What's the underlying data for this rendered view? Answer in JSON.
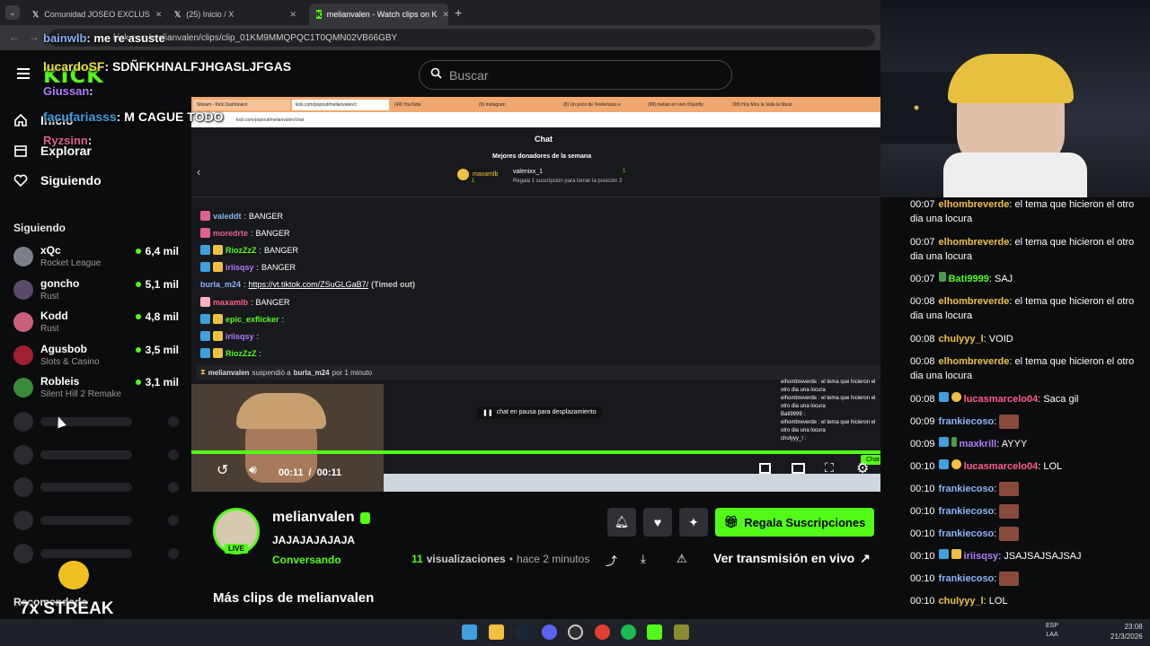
{
  "browser": {
    "tabs": [
      {
        "label": "Comunidad JOSEO EXCLUS",
        "active": false
      },
      {
        "label": "(25) Inicio / X",
        "active": false
      },
      {
        "label": "melianvalen - Watch clips on K",
        "active": true
      }
    ],
    "new_tab": "+",
    "url": "kick.com/melianvalen/clips/clip_01KM9MMQPQC1T0QMN02VB66GBY"
  },
  "kick": {
    "logo": "KICK",
    "search_placeholder": "Buscar",
    "nav": [
      {
        "label": "Inicio",
        "icon": "home-icon"
      },
      {
        "label": "Explorar",
        "icon": "compass-icon"
      },
      {
        "label": "Siguiendo",
        "icon": "heart-icon"
      }
    ],
    "following_title": "Siguiendo",
    "following": [
      {
        "name": "xQc",
        "game": "Rocket League",
        "viewers": "6,4 mil",
        "color": "#7a7f8a"
      },
      {
        "name": "goncho",
        "game": "Rust",
        "viewers": "5,1 mil",
        "color": "#5a4a6a"
      },
      {
        "name": "Kodd",
        "game": "Rust",
        "viewers": "4,8 mil",
        "color": "#c8607a"
      },
      {
        "name": "Agusbob",
        "game": "Slots & Casino",
        "viewers": "3,5 mil",
        "color": "#a02030"
      },
      {
        "name": "Robleis",
        "game": "Silent Hill 2 Remake",
        "viewers": "3,1 mil",
        "color": "#3a8a3a"
      }
    ],
    "recommended_title": "Recomendado"
  },
  "video": {
    "inner_tabs": [
      "Stream - Kick Dashboard",
      "kick.com/popout/melianvalen/c",
      "(49) YouTube",
      "(9) Instagram",
      "(8) Un poco de Tendencias e",
      "(98) melian en vivo #Spotify",
      "(98) Hoy Miru la Valla la Music"
    ],
    "inner_url": "kick.com/popout/melianvalen/chat",
    "chat_title": "Chat",
    "donors_title": "Mejores donadores de la semana",
    "donors": [
      {
        "name": "maxamlb",
        "count": "1"
      },
      {
        "name": "valenixx_1",
        "count": "1"
      }
    ],
    "donor_hint": "Regala 1 suscripción para tomar la posición 3",
    "messages": [
      {
        "user": "valeddt",
        "color": "#8ab4f8",
        "text": "BANGER"
      },
      {
        "user": "moredrte",
        "color": "#e06090",
        "text": "BANGER"
      },
      {
        "user": "RiozZzZ",
        "color": "#53fc18",
        "text": "BANGER"
      },
      {
        "user": "iriisqsy",
        "color": "#b07cff",
        "text": "BANGER"
      },
      {
        "user": "burla_m24",
        "color": "#8ab4f8",
        "text": "https://vt.tiktok.com/ZSuGLGaB7/",
        "suffix": "(Timed out)"
      },
      {
        "user": "maxamlb",
        "color": "#ff5e8a",
        "text": "BANGER"
      },
      {
        "user": "epic_exflicker",
        "color": "#53fc18",
        "text": ""
      },
      {
        "user": "iriisqsy",
        "color": "#b07cff",
        "text": ""
      },
      {
        "user": "RiozZzZ",
        "color": "#53fc18",
        "text": ""
      }
    ],
    "mod_action": {
      "mod": "melianvalen",
      "action": "suspendió a",
      "target": "burla_m24",
      "duration": "por 1 minuto"
    },
    "paused": "chat en pausa para desplazamiento",
    "time_current": "00:11",
    "time_sep": "/",
    "time_total": "00:11",
    "progress": 1.0,
    "mini_chat": [
      "elhombreverde : el tema que hicieron el",
      "otro dia una locura",
      "elhombreverde : el tema que hicieron el",
      "otro dia una locura",
      "Bati9999 :",
      "elhombreverde : el tema que hicieron el",
      "otro dia una locura",
      "chulyyy_l :"
    ],
    "mini_chat_button": "Chat"
  },
  "clip": {
    "streamer": "melianvalen",
    "title": "JAJAJAJAJAJA",
    "category": "Conversando",
    "live_badge": "LIVE",
    "views": "11",
    "views_label": "visualizaciones",
    "ago": "hace 2 minutos",
    "gift_button": "Regala Suscripciones",
    "watch_live": "Ver transmisión en vivo",
    "more_clips": "Más clips de melianvalen"
  },
  "overlay": {
    "lines": [
      {
        "user": "bainwlb",
        "text": "me re asuste"
      },
      {
        "user": "lucardoSF",
        "text": "SDÑFKHNALFJHGASLJFGAS"
      },
      {
        "user": "Giussan",
        "text": ""
      },
      {
        "user": "facufariasss",
        "text": "M CAGUE TODO"
      },
      {
        "user": "Ryzsinn",
        "text": ""
      }
    ],
    "streak": "7x STREAK"
  },
  "right_chat": [
    {
      "time": "00:07",
      "user": "elhombreverde",
      "color": "#f0c040",
      "text": "el tema que hicieron el otro dia una locura"
    },
    {
      "time": "00:07",
      "user": "elhombreverde",
      "color": "#f0c040",
      "text": "el tema que hicieron el otro dia una locura"
    },
    {
      "time": "00:07",
      "user": "Bati9999",
      "color": "#53fc18",
      "text": "SAJ"
    },
    {
      "time": "00:08",
      "user": "elhombreverde",
      "color": "#f0c040",
      "text": "el tema que hicieron el otro dia una locura"
    },
    {
      "time": "00:08",
      "user": "chulyyy_l",
      "color": "#f0c040",
      "text": "VOID"
    },
    {
      "time": "00:08",
      "user": "elhombreverde",
      "color": "#f0c040",
      "text": "el tema que hicieron el otro dia una locura"
    },
    {
      "time": "00:08",
      "user": "lucasmarcelo04",
      "color": "#ff5e8a",
      "text": "Saca gil"
    },
    {
      "time": "00:09",
      "user": "frankiecoso",
      "color": "#8ab4f8",
      "text": ""
    },
    {
      "time": "00:09",
      "user": "maxkrill",
      "color": "#b07cff",
      "text": "AYYY"
    },
    {
      "time": "00:10",
      "user": "lucasmarcelo04",
      "color": "#ff5e8a",
      "text": "LOL"
    },
    {
      "time": "00:10",
      "user": "frankiecoso",
      "color": "#8ab4f8",
      "text": ""
    },
    {
      "time": "00:10",
      "user": "frankiecoso",
      "color": "#8ab4f8",
      "text": ""
    },
    {
      "time": "00:10",
      "user": "frankiecoso",
      "color": "#8ab4f8",
      "text": ""
    },
    {
      "time": "00:10",
      "user": "iriisqsy",
      "color": "#b07cff",
      "text": "JSAJSAJSAJSAJ"
    },
    {
      "time": "00:10",
      "user": "frankiecoso",
      "color": "#8ab4f8",
      "text": ""
    },
    {
      "time": "00:10",
      "user": "chulyyy_l",
      "color": "#f0c040",
      "text": "LOL"
    }
  ],
  "taskbar": {
    "lang": "ESP",
    "lang2": "LAA",
    "time": "23:08",
    "date": "21/3/2026"
  },
  "colors": {
    "accent": "#53fc18",
    "bg": "#0b0c0e"
  }
}
